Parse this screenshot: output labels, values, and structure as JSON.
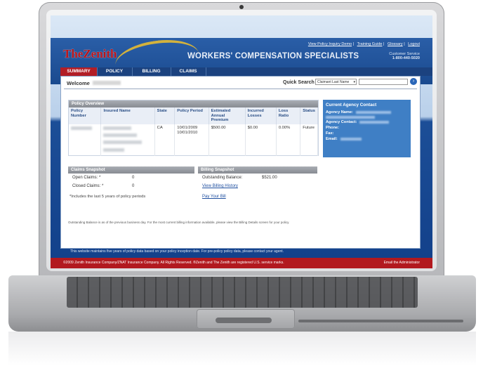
{
  "header": {
    "logo": "TheZenith",
    "tagline": "WORKERS' COMPENSATION SPECIALISTS",
    "top_links": [
      "View Policy Inquiry Demo",
      "Training Guide",
      "Glossary",
      "Logout"
    ],
    "customer_service_label": "Customer Service",
    "customer_service_phone": "1-800-440-5020"
  },
  "nav": {
    "tabs": [
      "SUMMARY",
      "POLICY",
      "BILLING",
      "CLAIMS"
    ]
  },
  "welcome": {
    "label": "Welcome"
  },
  "quick_search": {
    "label": "Quick Search",
    "selected": "Claimant Last Name",
    "value": ""
  },
  "policy_overview": {
    "title": "Policy Overview",
    "columns": [
      "Policy Number",
      "Insured Name",
      "State",
      "Policy Period",
      "Estimated Annual Premium",
      "Incurred Losses",
      "Loss Ratio",
      "Status"
    ],
    "row": {
      "state": "CA",
      "period": "10/01/2009 10/01/2010",
      "premium": "$500.00",
      "losses": "$0.00",
      "ratio": "0.00%",
      "status": "Future"
    }
  },
  "agency_contact": {
    "title": "Current Agency Contact",
    "labels": [
      "Agency Name:",
      "Agency Contact:",
      "Phone:",
      "Fax:",
      "Email:"
    ]
  },
  "claims_snapshot": {
    "title": "Claims Snapshot",
    "open_label": "Open Claims: *",
    "open_value": "0",
    "closed_label": "Closed Claims: *",
    "closed_value": "0",
    "note": "*Includes the last 5 years of policy periods"
  },
  "billing_snapshot": {
    "title": "Billing Snapshot",
    "balance_label": "Outstanding Balance:",
    "balance_value": "$521.00",
    "history_link": "View Billing History",
    "pay_link": "Pay Your Bill"
  },
  "balance_note": "Outstanding Balance is as of the previous business day. For the most current billing information available, please view the Billing Details screen for your policy.",
  "disclaimer": "This website maintains five years of policy data based on your policy inception date. For pre-policy policy data, please contact your agent.",
  "footer": {
    "copyright": "©2009 Zenith Insurance Company/ZNAT Insurance Company. All Rights Reserved. ®Zenith and The Zenith are registered U.S. service marks.",
    "admin_link": "Email the Administrator"
  },
  "colors": {
    "brand_red": "#b21e26",
    "brand_blue": "#1a4a8f",
    "panel_blue": "#3f7fc5"
  }
}
